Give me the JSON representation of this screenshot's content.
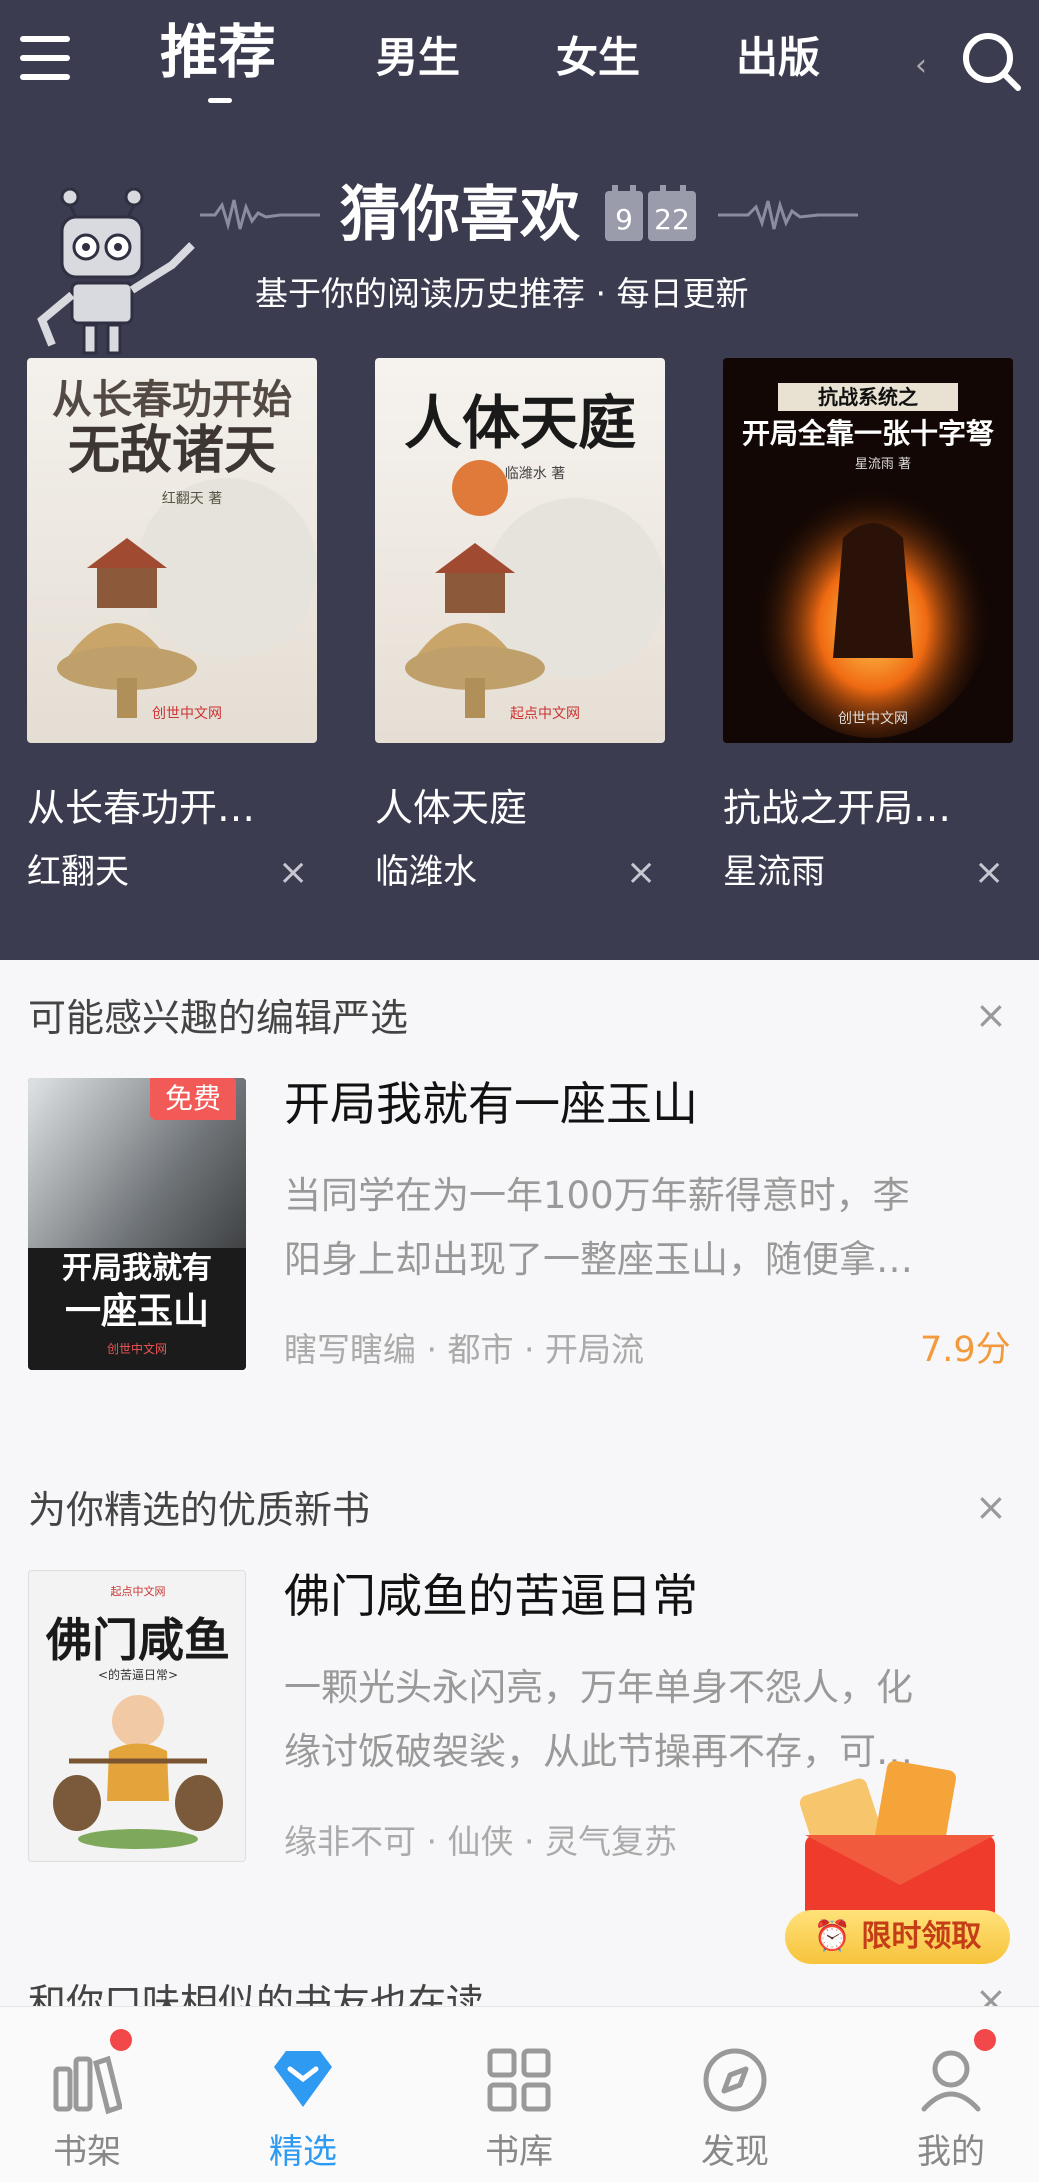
{
  "topnav": {
    "tabs": [
      {
        "label": "推荐",
        "active": true
      },
      {
        "label": "男生",
        "active": false
      },
      {
        "label": "女生",
        "active": false
      },
      {
        "label": "出版",
        "active": false
      }
    ],
    "icons": {
      "menu": "menu-icon",
      "search": "search-icon"
    }
  },
  "guess": {
    "title": "猜你喜欢",
    "date_month": "9",
    "date_day": "22",
    "subtitle": "基于你的阅读历史推荐 · 每日更新",
    "books": [
      {
        "title": "从长春功开…",
        "author": "红翻天",
        "cover_title": "从长春功开始无敌诸天",
        "cover_author": "红翻天 著",
        "cover_publisher": "创世中文网"
      },
      {
        "title": "人体天庭",
        "author": "临潍水",
        "cover_title": "人体天庭",
        "cover_author": "临潍水 著",
        "cover_publisher": "起点中文网"
      },
      {
        "title": "抗战之开局…",
        "author": "星流雨",
        "cover_title": "开局全靠一张十字弩",
        "cover_series": "抗战系统之",
        "cover_author": "星流雨 著",
        "cover_publisher": "创世中文网"
      }
    ]
  },
  "editor_pick": {
    "section_title": "可能感兴趣的编辑严选",
    "book": {
      "title": "开局我就有一座玉山",
      "badge": "免费",
      "desc_lines": [
        "当同学在为一年100万年薪得意时，李",
        "阳身上却出现了一整座玉山，随便拿…"
      ],
      "meta": "瞎写瞎编 · 都市 · 开局流",
      "score": "7.9分",
      "cover_text": [
        "开局我就有",
        "一座玉山"
      ],
      "cover_publisher": "创世中文网"
    }
  },
  "new_books": {
    "section_title": "为你精选的优质新书",
    "book": {
      "title": "佛门咸鱼的苦逼日常",
      "desc_lines": [
        "一颗光头永闪亮，万年单身不怨人，化",
        "缘讨饭破袈裟，从此节操再不存，可…"
      ],
      "meta": "缘非不可 · 仙侠 · 灵气复苏",
      "cover_text": "佛门咸鱼",
      "cover_sub": "<的苦逼日常>",
      "cover_publisher": "起点中文网"
    }
  },
  "similar": {
    "section_title": "和你口味相似的书友也在读"
  },
  "promo": {
    "button_label": "限时领取"
  },
  "bottom_nav": [
    {
      "label": "书架",
      "icon": "bookshelf-icon",
      "active": false,
      "dot": true
    },
    {
      "label": "精选",
      "icon": "diamond-icon",
      "active": true,
      "dot": false
    },
    {
      "label": "书库",
      "icon": "grid-icon",
      "active": false,
      "dot": false
    },
    {
      "label": "发现",
      "icon": "compass-icon",
      "active": false,
      "dot": false
    },
    {
      "label": "我的",
      "icon": "user-icon",
      "active": false,
      "dot": true
    }
  ],
  "colors": {
    "header_bg": "#3b3c50",
    "accent_blue": "#2e9af2",
    "score_orange": "#f29a3c",
    "badge_red": "#f25a58"
  }
}
